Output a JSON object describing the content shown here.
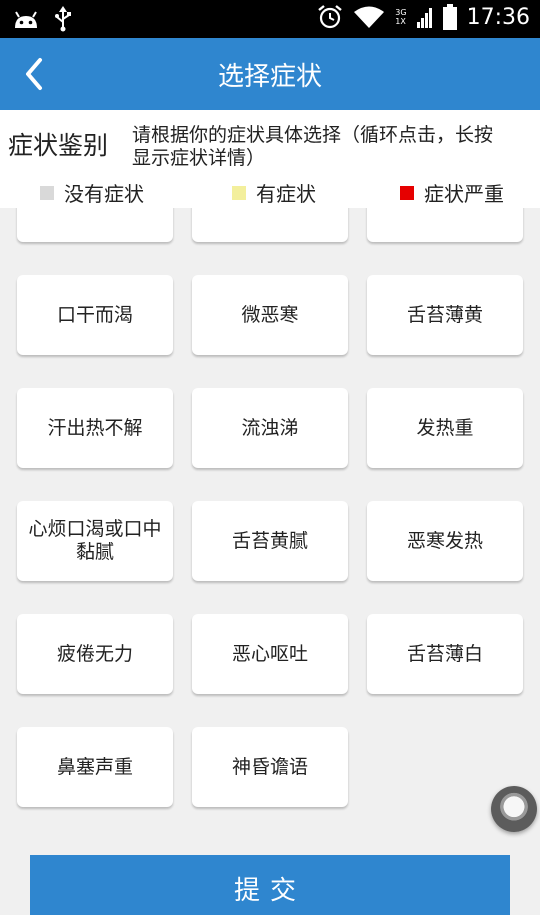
{
  "status_bar": {
    "time": "17:36",
    "network_top": "3G",
    "network_bottom": "1X",
    "icons": [
      "android-icon",
      "usb-icon",
      "alarm-icon",
      "wifi-icon",
      "signal-icon",
      "battery-icon"
    ]
  },
  "titlebar": {
    "title": "选择症状",
    "background": "#2f86cf"
  },
  "header": {
    "label": "症状鉴别",
    "description_line1": "请根据你的症状具体选择（循环点击，长按",
    "description_line2": "显示症状详情）"
  },
  "legend": [
    {
      "label": "没有症状",
      "color": "#d9d9d9"
    },
    {
      "label": "有症状",
      "color": "#f3ef9c"
    },
    {
      "label": "症状严重",
      "color": "#e60000"
    }
  ],
  "symptoms": [
    {
      "label": "口干而渴"
    },
    {
      "label": "微恶寒"
    },
    {
      "label": "舌苔薄黄"
    },
    {
      "label": "汗出热不解"
    },
    {
      "label": "流浊涕"
    },
    {
      "label": "发热重"
    },
    {
      "label": "心烦口渴或口中黏腻"
    },
    {
      "label": "舌苔黄腻"
    },
    {
      "label": "恶寒发热"
    },
    {
      "label": "疲倦无力"
    },
    {
      "label": "恶心呕吐"
    },
    {
      "label": "舌苔薄白"
    },
    {
      "label": "鼻塞声重"
    },
    {
      "label": "神昏谵语"
    }
  ],
  "submit_label": "提交"
}
